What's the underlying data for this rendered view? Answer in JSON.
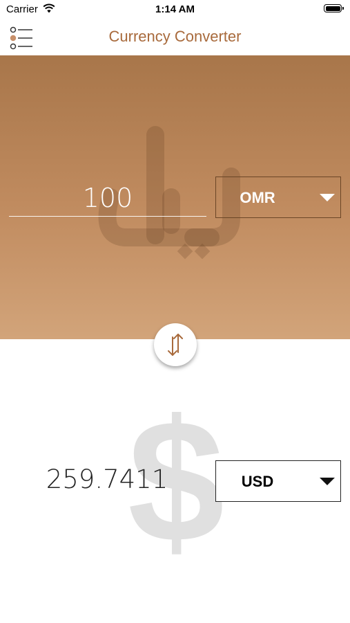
{
  "status_bar": {
    "carrier": "Carrier",
    "time": "1:14 AM"
  },
  "nav": {
    "title": "Currency Converter",
    "menu_icon": "list-menu-icon"
  },
  "from": {
    "amount": "100",
    "currency": "OMR",
    "watermark_icon": "rial-symbol-icon",
    "panel_color_top": "#a8764a",
    "panel_color_bottom": "#d2a47a"
  },
  "swap": {
    "icon": "swap-arrows-icon"
  },
  "to": {
    "amount": "259.7411",
    "currency": "USD",
    "watermark_symbol": "$"
  },
  "colors": {
    "accent": "#a86a3c",
    "select_border_dark": "#6a4526"
  }
}
